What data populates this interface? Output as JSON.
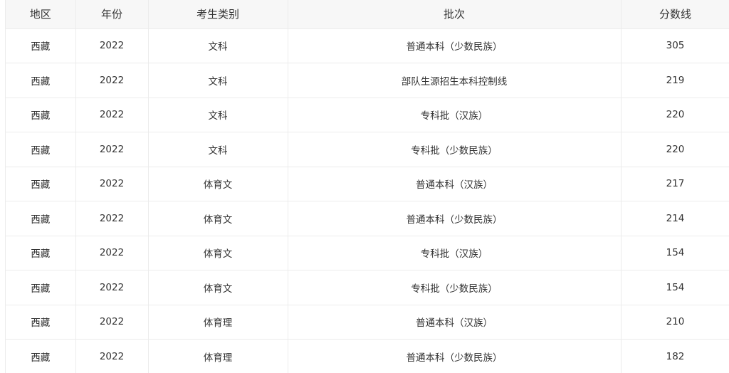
{
  "table": {
    "columns": [
      "地区",
      "年份",
      "考生类别",
      "批次",
      "分数线"
    ],
    "rows": [
      [
        "西藏",
        "2022",
        "文科",
        "普通本科（少数民族）",
        "305"
      ],
      [
        "西藏",
        "2022",
        "文科",
        "部队生源招生本科控制线",
        "219"
      ],
      [
        "西藏",
        "2022",
        "文科",
        "专科批（汉族）",
        "220"
      ],
      [
        "西藏",
        "2022",
        "文科",
        "专科批（少数民族）",
        "220"
      ],
      [
        "西藏",
        "2022",
        "体育文",
        "普通本科（汉族）",
        "217"
      ],
      [
        "西藏",
        "2022",
        "体育文",
        "普通本科（少数民族）",
        "214"
      ],
      [
        "西藏",
        "2022",
        "体育文",
        "专科批（汉族）",
        "154"
      ],
      [
        "西藏",
        "2022",
        "体育文",
        "专科批（少数民族）",
        "154"
      ],
      [
        "西藏",
        "2022",
        "体育理",
        "普通本科（汉族）",
        "210"
      ],
      [
        "西藏",
        "2022",
        "体育理",
        "普通本科（少数民族）",
        "182"
      ]
    ]
  }
}
